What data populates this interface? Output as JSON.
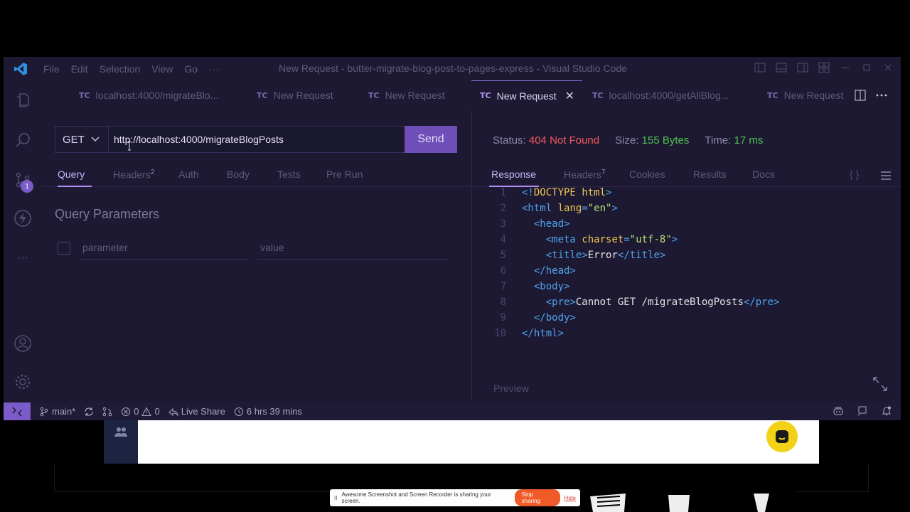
{
  "window": {
    "title": "New Request - butter-migrate-blog-post-to-pages-express - Visual Studio Code",
    "menu": [
      "File",
      "Edit",
      "Selection",
      "View",
      "Go",
      "···"
    ]
  },
  "activity": {
    "scm_badge": "1",
    "more": "···"
  },
  "tabs": [
    {
      "badge": "TC",
      "label": "localhost:4000/migrateBlo..."
    },
    {
      "badge": "TC",
      "label": "New Request"
    },
    {
      "badge": "TC",
      "label": "New Request"
    },
    {
      "badge": "TC",
      "label": "New Request",
      "close": "✕"
    },
    {
      "badge": "TC",
      "label": "localhost:4000/getAllBlog..."
    },
    {
      "badge": "TC",
      "label": "New Request"
    }
  ],
  "request": {
    "method": "GET",
    "url": "http://localhost:4000/migrateBlogPosts",
    "send_label": "Send",
    "tabs": [
      {
        "label": "Query",
        "count": ""
      },
      {
        "label": "Headers",
        "count": "2"
      },
      {
        "label": "Auth",
        "count": ""
      },
      {
        "label": "Body",
        "count": ""
      },
      {
        "label": "Tests",
        "count": ""
      },
      {
        "label": "Pre Run",
        "count": ""
      }
    ],
    "query_title": "Query Parameters",
    "param_placeholder": "parameter",
    "value_placeholder": "value"
  },
  "response": {
    "status_label": "Status:",
    "status_value": "404 Not Found",
    "size_label": "Size:",
    "size_value": "155 Bytes",
    "time_label": "Time:",
    "time_value": "17 ms",
    "tabs": [
      {
        "label": "Response",
        "count": ""
      },
      {
        "label": "Headers",
        "count": "7"
      },
      {
        "label": "Cookies",
        "count": ""
      },
      {
        "label": "Results",
        "count": ""
      },
      {
        "label": "Docs",
        "count": ""
      }
    ],
    "braces": "{ }",
    "preview_label": "Preview",
    "line_numbers": [
      "1",
      "2",
      "3",
      "4",
      "5",
      "6",
      "7",
      "8",
      "9",
      "10"
    ]
  },
  "statusbar": {
    "branch": "main*",
    "errors": "0",
    "warnings": "0",
    "live_share": "Live Share",
    "time_tracked": "6 hrs 39 mins"
  },
  "share_bar": {
    "pause": "II",
    "message": "Awesome Screenshot and Screen Recorder is sharing your screen.",
    "stop_label": "Stop sharing",
    "hide_label": "Hide"
  },
  "colors": {
    "accent": "#7a5bc8",
    "status_error": "#f45a5a",
    "status_ok": "#4fc24f",
    "editor_bg": "#1d1933"
  }
}
